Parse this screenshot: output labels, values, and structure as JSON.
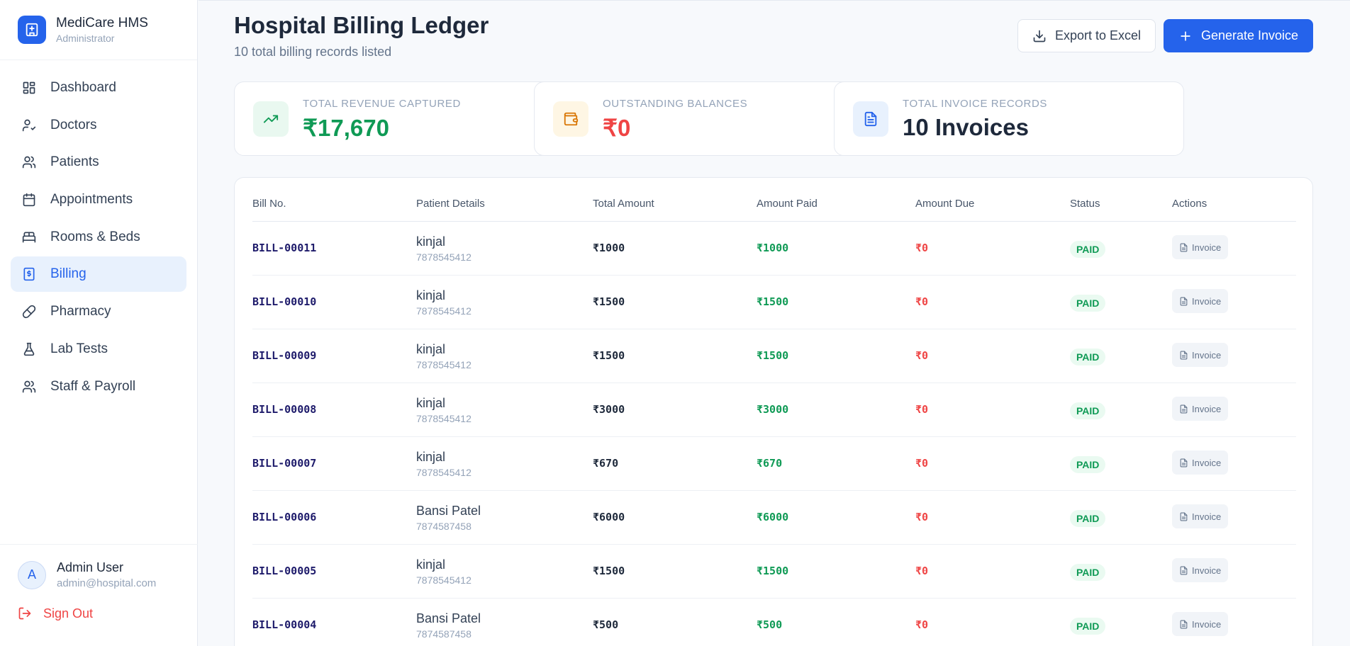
{
  "brand": {
    "name": "MediCare HMS",
    "role": "Administrator"
  },
  "nav": [
    {
      "label": "Dashboard",
      "icon": "dashboard-icon",
      "active": false
    },
    {
      "label": "Doctors",
      "icon": "doctor-icon",
      "active": false
    },
    {
      "label": "Patients",
      "icon": "patients-icon",
      "active": false
    },
    {
      "label": "Appointments",
      "icon": "calendar-icon",
      "active": false
    },
    {
      "label": "Rooms & Beds",
      "icon": "bed-icon",
      "active": false
    },
    {
      "label": "Billing",
      "icon": "billing-icon",
      "active": true
    },
    {
      "label": "Pharmacy",
      "icon": "pill-icon",
      "active": false
    },
    {
      "label": "Lab Tests",
      "icon": "flask-icon",
      "active": false
    },
    {
      "label": "Staff & Payroll",
      "icon": "staff-icon",
      "active": false
    }
  ],
  "user": {
    "initial": "A",
    "name": "Admin User",
    "email": "admin@hospital.com",
    "signout": "Sign Out"
  },
  "header": {
    "title": "Hospital Billing Ledger",
    "subtitle": "10 total billing records listed",
    "export_label": "Export to Excel",
    "generate_label": "Generate Invoice"
  },
  "stats": [
    {
      "label": "TOTAL REVENUE CAPTURED",
      "value": "₹17,670",
      "color": "#0f9a55",
      "icon": "trending-up-icon"
    },
    {
      "label": "OUTSTANDING BALANCES",
      "value": "₹0",
      "color": "#ef4444",
      "icon": "wallet-icon"
    },
    {
      "label": "TOTAL INVOICE RECORDS",
      "value": "10 Invoices",
      "color": "#1e293b",
      "icon": "document-icon"
    }
  ],
  "table": {
    "columns": [
      "Bill No.",
      "Patient Details",
      "Total Amount",
      "Amount Paid",
      "Amount Due",
      "Status",
      "Actions"
    ],
    "action_label": "Invoice",
    "rows": [
      {
        "bill": "BILL-00011",
        "name": "kinjal",
        "phone": "7878545412",
        "total": "₹1000",
        "paid": "₹1000",
        "due": "₹0",
        "status": "PAID"
      },
      {
        "bill": "BILL-00010",
        "name": "kinjal",
        "phone": "7878545412",
        "total": "₹1500",
        "paid": "₹1500",
        "due": "₹0",
        "status": "PAID"
      },
      {
        "bill": "BILL-00009",
        "name": "kinjal",
        "phone": "7878545412",
        "total": "₹1500",
        "paid": "₹1500",
        "due": "₹0",
        "status": "PAID"
      },
      {
        "bill": "BILL-00008",
        "name": "kinjal",
        "phone": "7878545412",
        "total": "₹3000",
        "paid": "₹3000",
        "due": "₹0",
        "status": "PAID"
      },
      {
        "bill": "BILL-00007",
        "name": "kinjal",
        "phone": "7878545412",
        "total": "₹670",
        "paid": "₹670",
        "due": "₹0",
        "status": "PAID"
      },
      {
        "bill": "BILL-00006",
        "name": "Bansi Patel",
        "phone": "7874587458",
        "total": "₹6000",
        "paid": "₹6000",
        "due": "₹0",
        "status": "PAID"
      },
      {
        "bill": "BILL-00005",
        "name": "kinjal",
        "phone": "7878545412",
        "total": "₹1500",
        "paid": "₹1500",
        "due": "₹0",
        "status": "PAID"
      },
      {
        "bill": "BILL-00004",
        "name": "Bansi Patel",
        "phone": "7874587458",
        "total": "₹500",
        "paid": "₹500",
        "due": "₹0",
        "status": "PAID"
      }
    ]
  },
  "colors": {
    "accent": "#2563eb",
    "paid": "#0f9a55",
    "due": "#ef4444",
    "bill": "#1e1b6b"
  }
}
